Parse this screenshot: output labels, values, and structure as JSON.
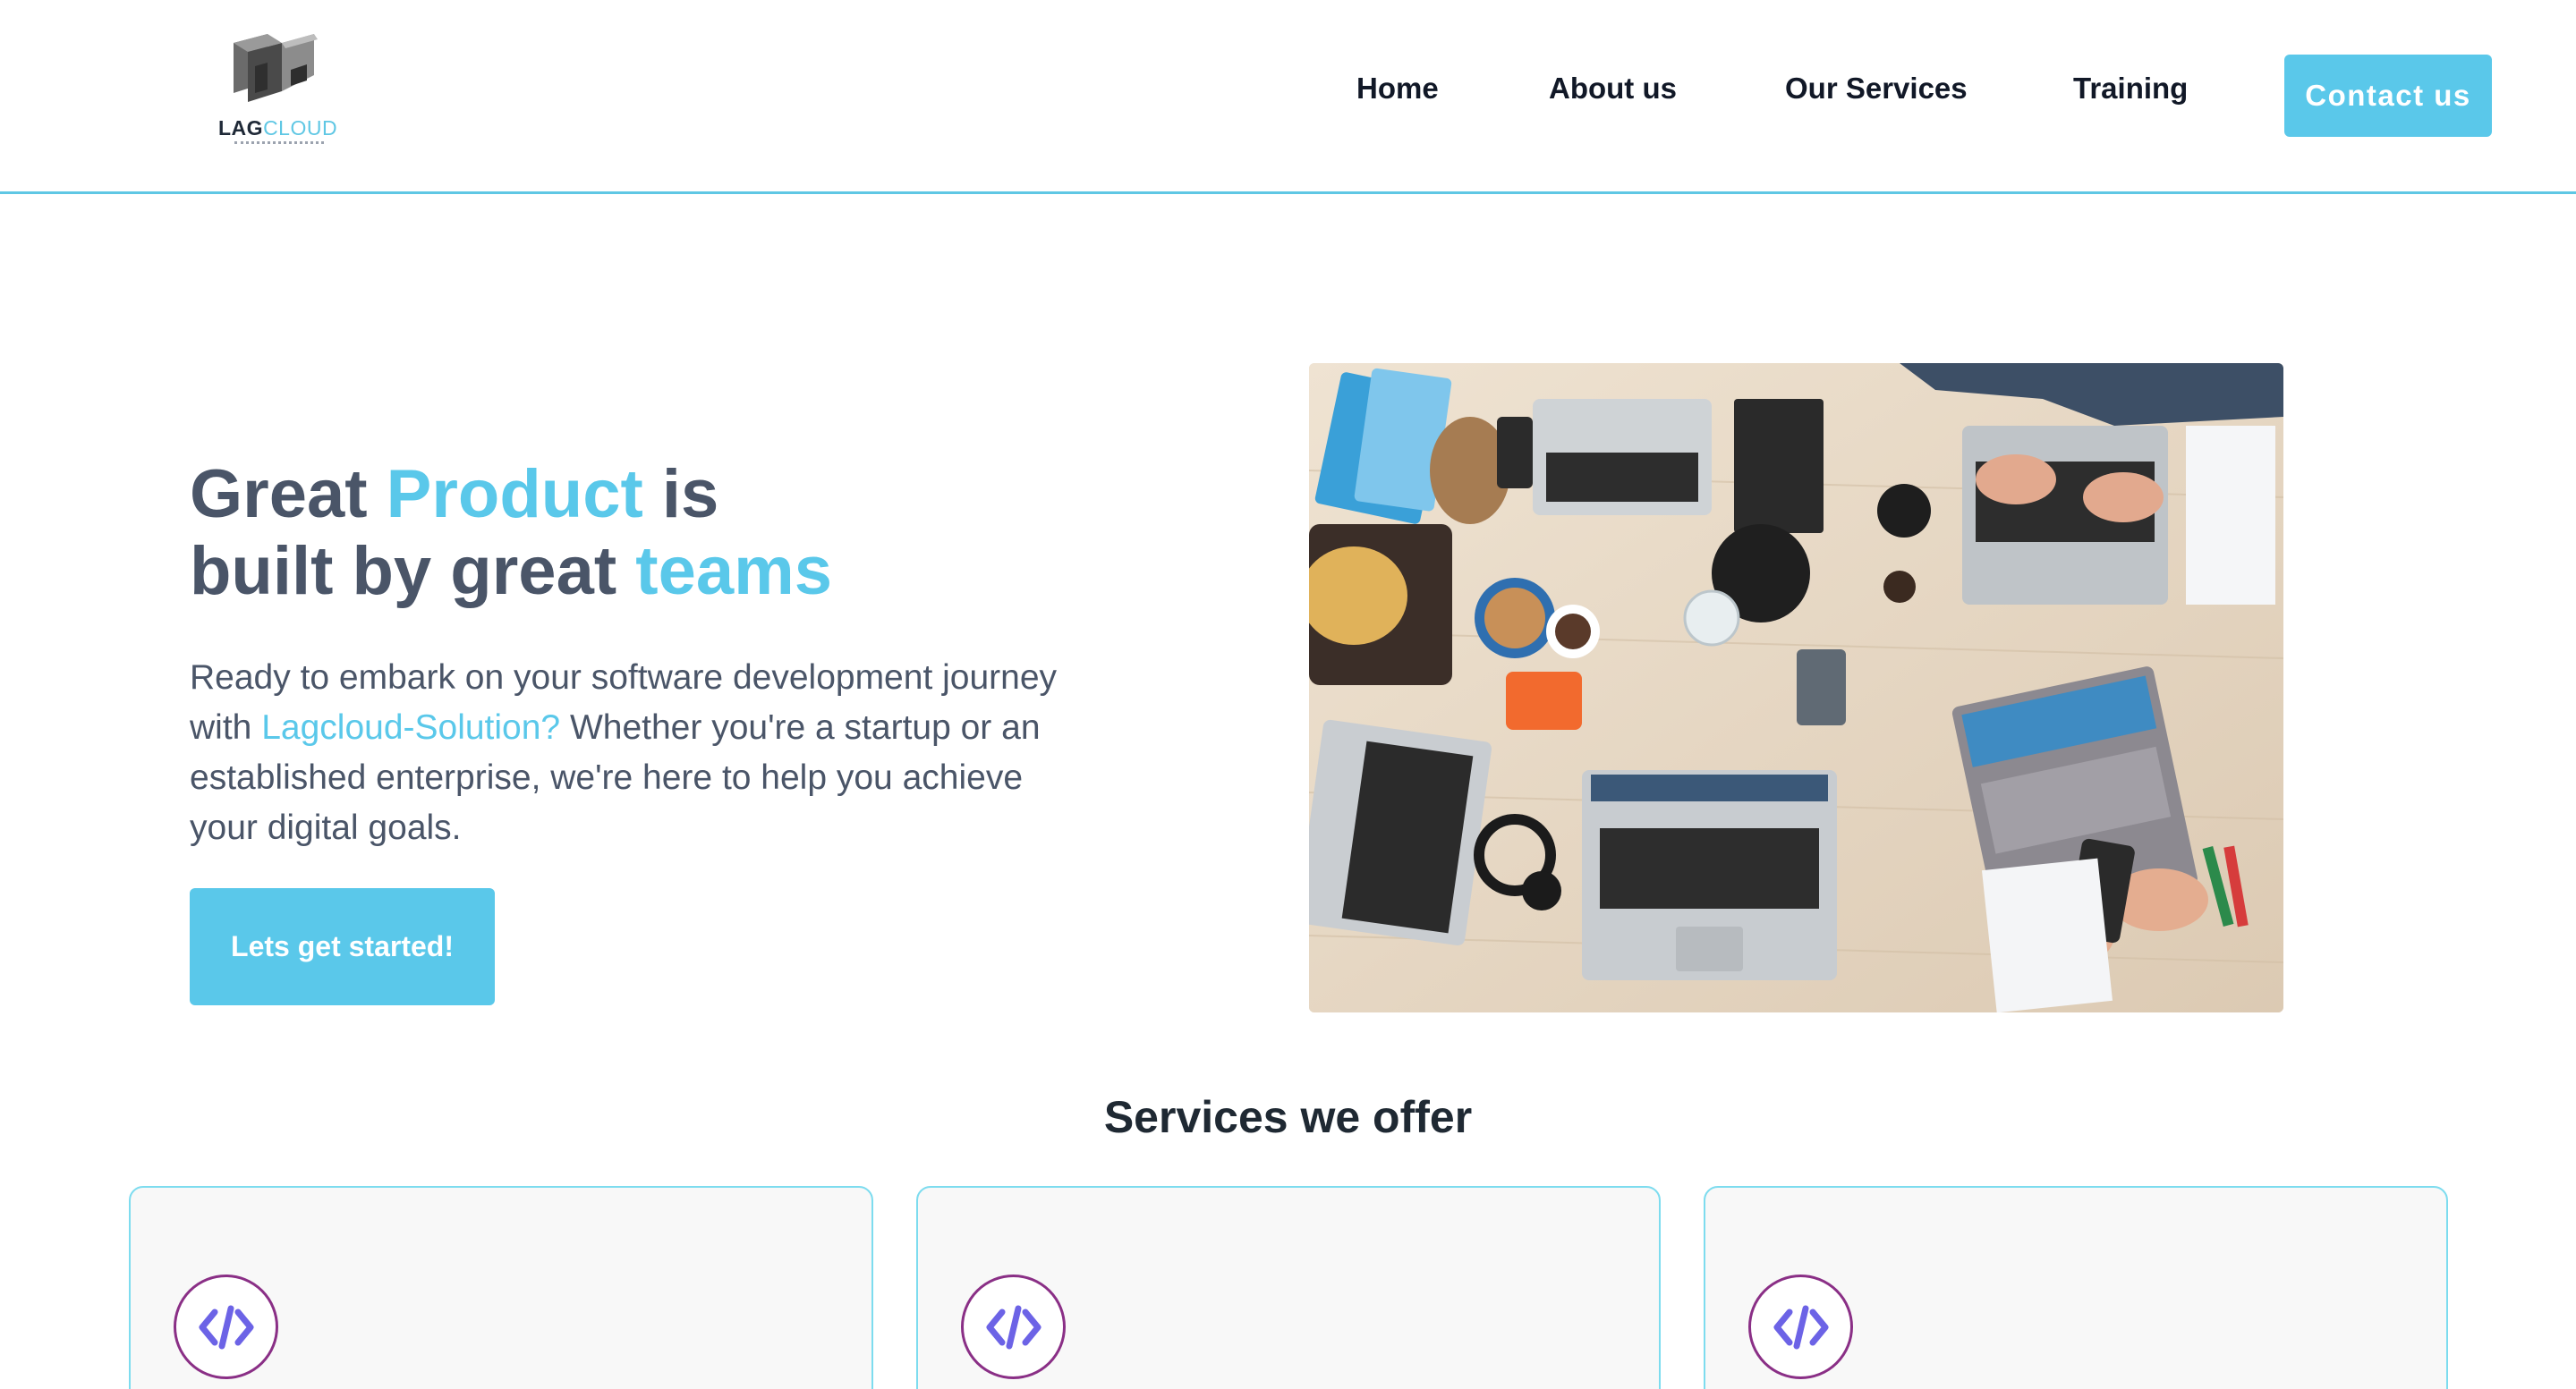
{
  "brand": {
    "logo_bold": "LAG",
    "logo_light": "CLOUD",
    "accent_color": "#5ac8ea"
  },
  "nav": {
    "items": [
      {
        "label": "Home"
      },
      {
        "label": "About us"
      },
      {
        "label": "Our Services"
      },
      {
        "label": "Training"
      }
    ],
    "contact_label": "Contact us"
  },
  "hero": {
    "title_part1": "Great ",
    "title_highlight1": "Product",
    "title_part2": " is",
    "title_part3": "built by great ",
    "title_highlight2": "teams",
    "desc_part1": "Ready to embark on your software development journey with ",
    "desc_link": "Lagcloud-Solution?",
    "desc_part2": " Whether you're a startup or an established enterprise, we're here to help you achieve your digital goals.",
    "cta_label": "Lets get started!"
  },
  "services": {
    "title": "Services we offer",
    "cards": [
      {
        "icon": "code-icon"
      },
      {
        "icon": "code-icon"
      },
      {
        "icon": "code-icon"
      }
    ]
  }
}
